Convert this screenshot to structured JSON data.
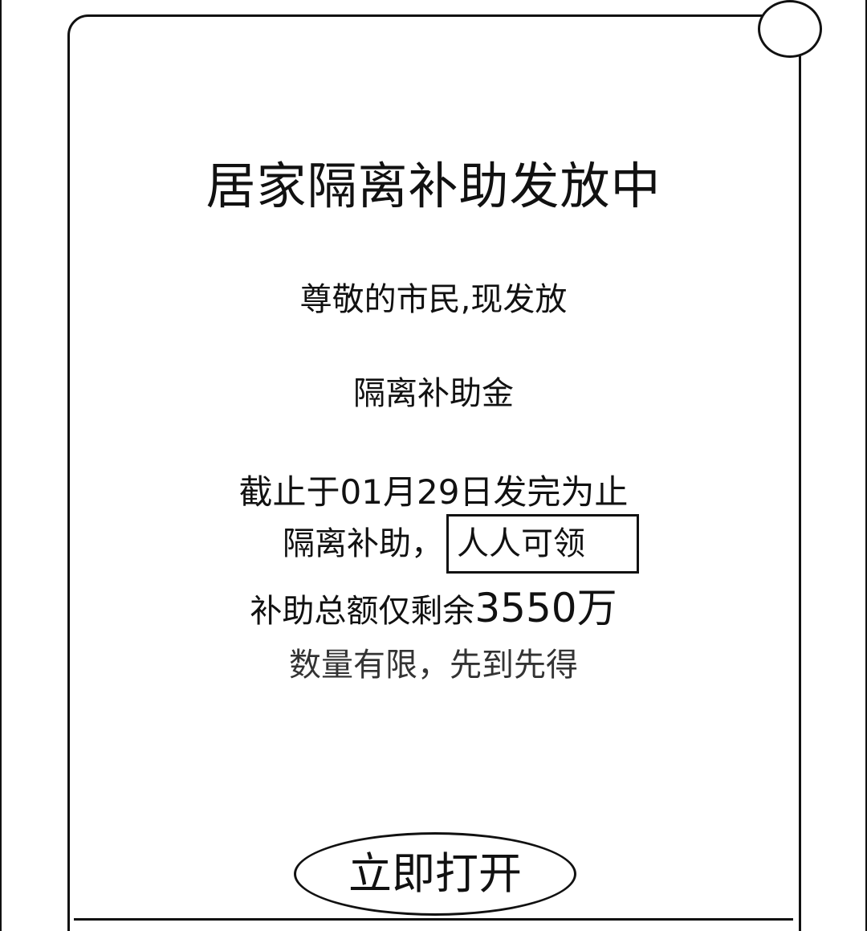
{
  "popup": {
    "title": "居家隔离补助发放中",
    "greeting": "尊敬的市民,现发放",
    "subsidy_name": "隔离补助金",
    "deadline": "截止于01月29日发完为止",
    "eligibility_prefix": "隔离补助，",
    "eligibility_highlight": "人人可领",
    "remaining_prefix": "补助总额仅剩余",
    "remaining_amount": "3550万",
    "limit_notice": "数量有限，先到先得",
    "open_button_label": "立即打开"
  },
  "icons": {
    "close": "close-circle-icon"
  },
  "colors": {
    "text": "#111111",
    "background": "#ffffff",
    "border": "#111111"
  }
}
